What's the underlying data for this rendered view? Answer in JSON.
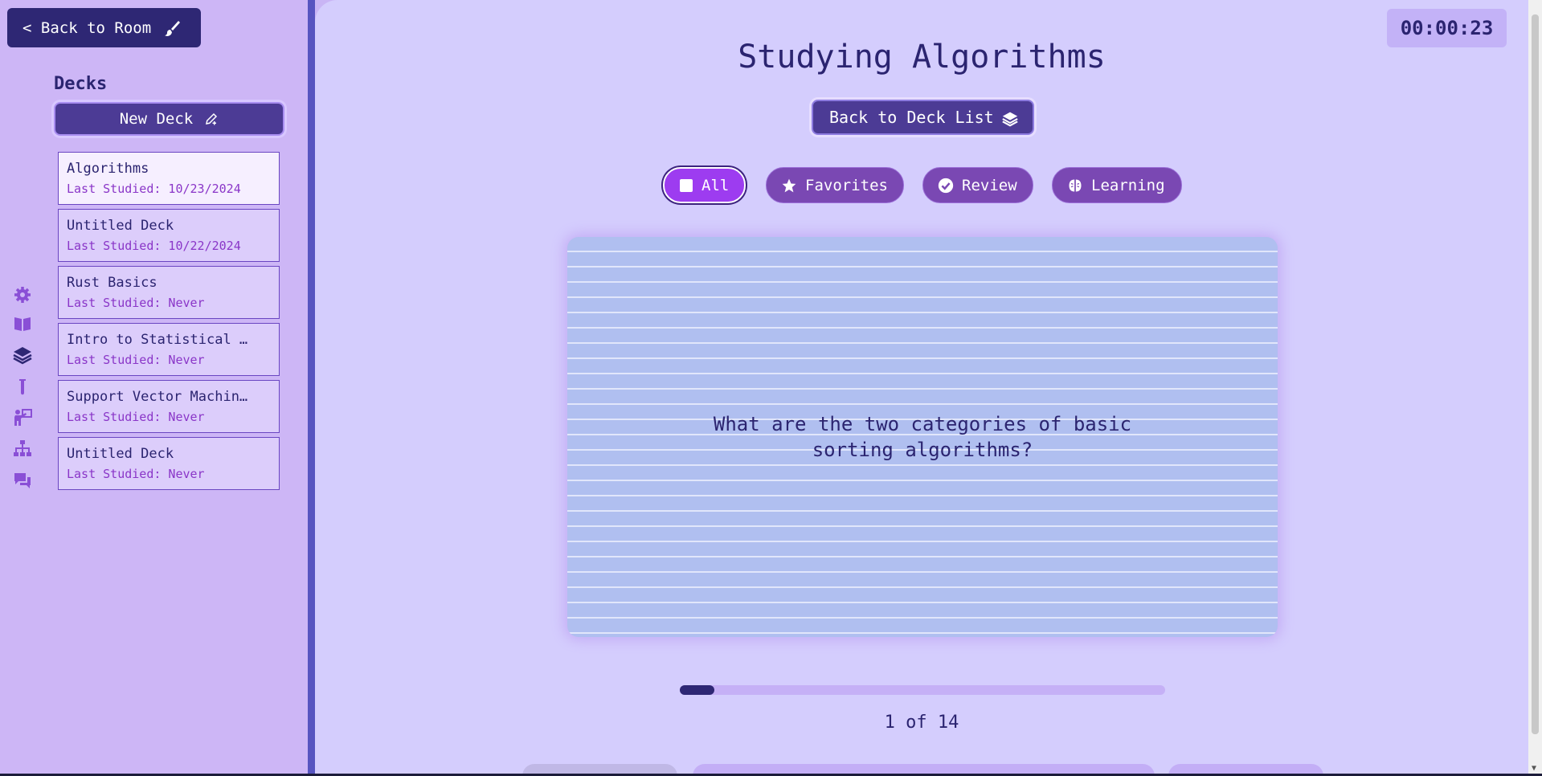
{
  "sidebar": {
    "back_room_label": "< Back to Room",
    "decks_heading": "Decks",
    "new_deck_label": "New Deck",
    "decks": [
      {
        "name": "Algorithms",
        "last_studied": "Last Studied: 10/23/2024",
        "active": true
      },
      {
        "name": "Untitled Deck",
        "last_studied": "Last Studied: 10/22/2024",
        "active": false
      },
      {
        "name": "Rust Basics",
        "last_studied": "Last Studied: Never",
        "active": false
      },
      {
        "name": "Intro to Statistical …",
        "last_studied": "Last Studied: Never",
        "active": false
      },
      {
        "name": "Support Vector Machin…",
        "last_studied": "Last Studied: Never",
        "active": false
      },
      {
        "name": "Untitled Deck",
        "last_studied": "Last Studied: Never",
        "active": false
      }
    ],
    "nav_icons": [
      "gear-icon",
      "book-icon",
      "layers-icon",
      "test-tube-icon",
      "teacher-icon",
      "sitemap-icon",
      "chat-icon"
    ]
  },
  "main": {
    "timer": "00:00:23",
    "title": "Studying Algorithms",
    "back_deck_label": "Back to Deck List",
    "filters": [
      {
        "label": "All",
        "icon": "square-icon",
        "active": true
      },
      {
        "label": "Favorites",
        "icon": "star-icon",
        "active": false
      },
      {
        "label": "Review",
        "icon": "check-circle-icon",
        "active": false
      },
      {
        "label": "Learning",
        "icon": "brain-icon",
        "active": false
      }
    ],
    "card_text": "What are the two categories of basic sorting algorithms?",
    "progress": {
      "current": 1,
      "total": 14,
      "fraction": 0.071
    },
    "counter_text": "1 of 14"
  },
  "colors": {
    "sidebar_bg": "#cdb6f6",
    "main_bg": "#d4cdfd",
    "accent_dark": "#2e2774",
    "button_bg": "#4c3b95",
    "filter_bg": "#7a48b3",
    "filter_active": "#9d3cf0",
    "deck_date": "#8a36c8"
  }
}
